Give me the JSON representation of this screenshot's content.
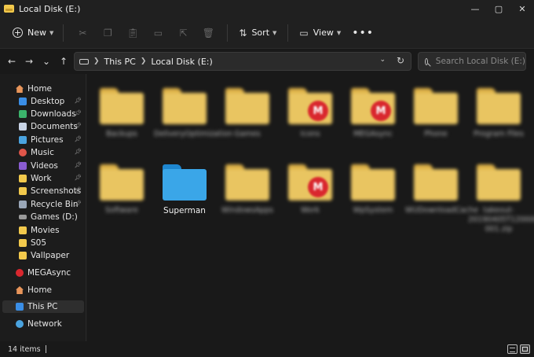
{
  "window": {
    "title": "Local Disk (E:)",
    "minimize": "—",
    "maximize": "▢",
    "close": "✕"
  },
  "toolbar": {
    "new_label": "New",
    "sort_label": "Sort",
    "view_label": "View",
    "more_label": "•••",
    "icons": [
      "cut-icon",
      "copy-icon",
      "paste-icon",
      "rename-icon",
      "share-icon",
      "delete-icon"
    ]
  },
  "address": {
    "crumbs": [
      "This PC",
      "Local Disk (E:)"
    ],
    "search_placeholder": "Search Local Disk (E:)"
  },
  "sidebar": {
    "items": [
      {
        "label": "Home",
        "icon": "home-icon",
        "pinned": false
      },
      {
        "label": "Desktop",
        "icon": "desktop-icon",
        "pinned": true
      },
      {
        "label": "Downloads",
        "icon": "downloads-icon",
        "pinned": true
      },
      {
        "label": "Documents",
        "icon": "documents-icon",
        "pinned": true
      },
      {
        "label": "Pictures",
        "icon": "pictures-icon",
        "pinned": true
      },
      {
        "label": "Music",
        "icon": "music-icon",
        "pinned": true
      },
      {
        "label": "Videos",
        "icon": "videos-icon",
        "pinned": true
      },
      {
        "label": "Work",
        "icon": "folder-icon",
        "pinned": true
      },
      {
        "label": "Screenshots",
        "icon": "folder-icon",
        "pinned": true
      },
      {
        "label": "Recycle Bin",
        "icon": "recycle-bin-icon",
        "pinned": true
      },
      {
        "label": "Games (D:)",
        "icon": "drive-icon",
        "pinned": false
      },
      {
        "label": "Movies",
        "icon": "folder-icon",
        "pinned": false
      },
      {
        "label": "S05",
        "icon": "folder-icon",
        "pinned": false
      },
      {
        "label": "Vallpaper",
        "icon": "folder-icon",
        "pinned": false
      },
      {
        "label": "MEGAsync",
        "icon": "mega-icon",
        "pinned": false
      },
      {
        "label": "Home",
        "icon": "home-icon",
        "pinned": false
      },
      {
        "label": "This PC",
        "icon": "this-pc-icon",
        "pinned": false,
        "selected": true
      },
      {
        "label": "Network",
        "icon": "network-icon",
        "pinned": false
      }
    ]
  },
  "content": {
    "items": [
      {
        "label": "Backups",
        "blurred": true
      },
      {
        "label": "DeliveryOptimization",
        "blurred": true
      },
      {
        "label": "Games",
        "blurred": true
      },
      {
        "label": "Icons",
        "blurred": true,
        "mega": true
      },
      {
        "label": "MEGAsync",
        "blurred": true,
        "mega": true
      },
      {
        "label": "Phone",
        "blurred": true
      },
      {
        "label": "Program Files",
        "blurred": true
      },
      {
        "label": "Software",
        "blurred": true
      },
      {
        "label": "Superman",
        "blurred": false,
        "color": "#3aa6e8"
      },
      {
        "label": "WindowsApps",
        "blurred": true
      },
      {
        "label": "Work",
        "blurred": true,
        "mega": true
      },
      {
        "label": "WpSystem",
        "blurred": true
      },
      {
        "label": "WUDownloadCache",
        "blurred": true
      },
      {
        "label": "takeout-20190405T120000Z-001.zip",
        "blurred": true
      }
    ]
  },
  "status": {
    "item_count": "14 items"
  }
}
